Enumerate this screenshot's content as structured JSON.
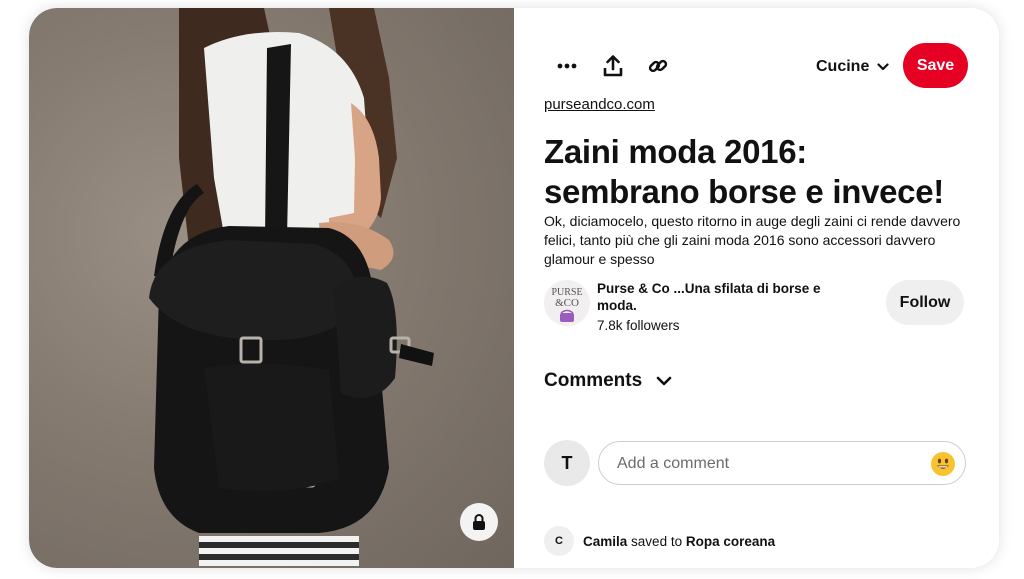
{
  "toolbar": {
    "more_icon": "ellipsis-icon",
    "share_icon": "share-upload-icon",
    "link_icon": "link-icon",
    "board_name": "Cucine",
    "save_label": "Save"
  },
  "pin": {
    "source": "purseandco.com",
    "title_line1": "Zaini moda 2016:",
    "title_line2": "sembrano borse e invece!",
    "description": "Ok, diciamocelo, questo ritorno in auge degli zaini ci rende davvero felici, tanto più che gli zaini moda 2016 sono accessori davvero glamour e spesso"
  },
  "creator": {
    "logo_text_line1": "PURSE",
    "logo_text_line2": "&CO",
    "name": "Purse & Co ...Una sfilata di borse e moda.",
    "followers": "7.8k followers",
    "follow_label": "Follow"
  },
  "comments": {
    "heading": "Comments",
    "user_initial": "T",
    "placeholder": "Add a comment"
  },
  "activity": {
    "avatar_initial": "C",
    "user": "Camila",
    "action": "saved to",
    "board": "Ropa coreana"
  },
  "colors": {
    "save_red": "#e60023",
    "follow_gray": "#efefef"
  }
}
